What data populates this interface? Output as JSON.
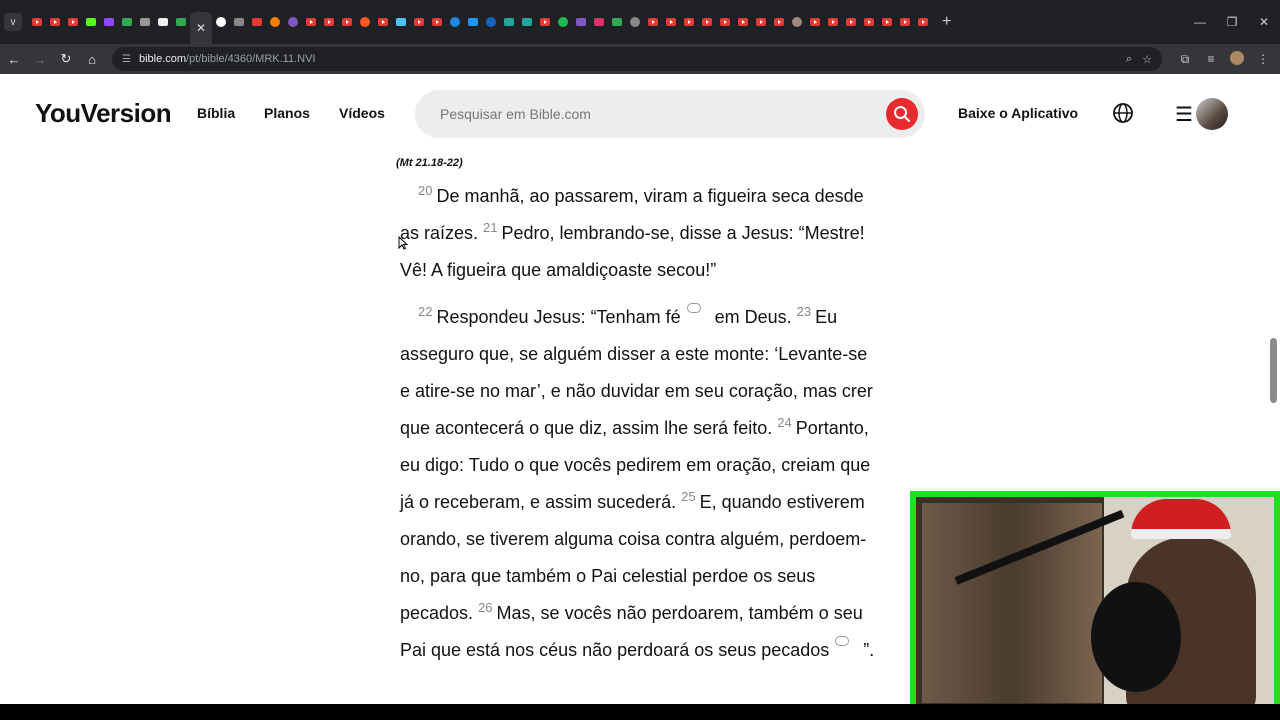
{
  "browser": {
    "tab_count_label": "v",
    "active_tab_close": "✕",
    "new_tab": "+",
    "url_host": "bible.com",
    "url_path": "/pt/bible/4360/MRK.11.NVI"
  },
  "header": {
    "logo": "YouVersion",
    "nav": [
      "Bíblia",
      "Planos",
      "Vídeos"
    ],
    "search_placeholder": "Pesquisar em Bible.com",
    "app_link": "Baixe o Aplicativo"
  },
  "content": {
    "reference": "(Mt 21.18-22)",
    "p1": {
      "v20_num": "20",
      "v20_text": "De manhã, ao passarem, viram a figueira seca desde as raízes.",
      "v21_num": "21",
      "v21_text": "Pedro, lembrando-se, disse a Jesus: “Mestre! Vê! A figueira que amaldiçoaste secou!”"
    },
    "p2": {
      "v22_num": "22",
      "v22_text_a": "Respondeu Jesus: “Tenham fé",
      "v22_text_b": "em Deus.",
      "v23_num": "23",
      "v23_text": "Eu asseguro que, se alguém disser a este monte: ‘Levante-se e atire-se no mar’, e não duvidar em seu coração, mas crer que acontecerá o que diz, assim lhe será feito.",
      "v24_num": "24",
      "v24_text": "Portanto, eu digo: Tudo o que vocês pedirem em oração, creiam que já o receberam, e assim sucederá.",
      "v25_num": "25",
      "v25_text": "E, quando estiverem orando, se tiverem alguma coisa contra alguém, perdoem-no, para que também o Pai celestial perdoe os seus pecados.",
      "v26_num": "26",
      "v26_text_a": "Mas, se vocês não perdoarem, também o seu Pai que está nos céus não perdoará os seus pecados",
      "v26_text_b": "”."
    }
  }
}
